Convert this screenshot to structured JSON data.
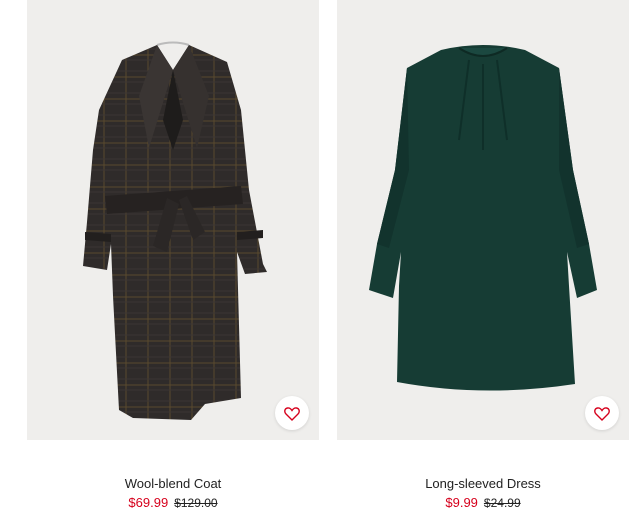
{
  "products": [
    {
      "title": "Wool-blend Coat",
      "sale_price": "$69.99",
      "original_price": "$129.00",
      "image_icon": "wool-coat-image",
      "favorite_icon": "heart-icon"
    },
    {
      "title": "Long-sleeved Dress",
      "sale_price": "$9.99",
      "original_price": "$24.99",
      "image_icon": "green-dress-image",
      "favorite_icon": "heart-icon"
    }
  ],
  "colors": {
    "sale": "#d6001c",
    "image_bg": "#efeeec",
    "text": "#222222"
  }
}
